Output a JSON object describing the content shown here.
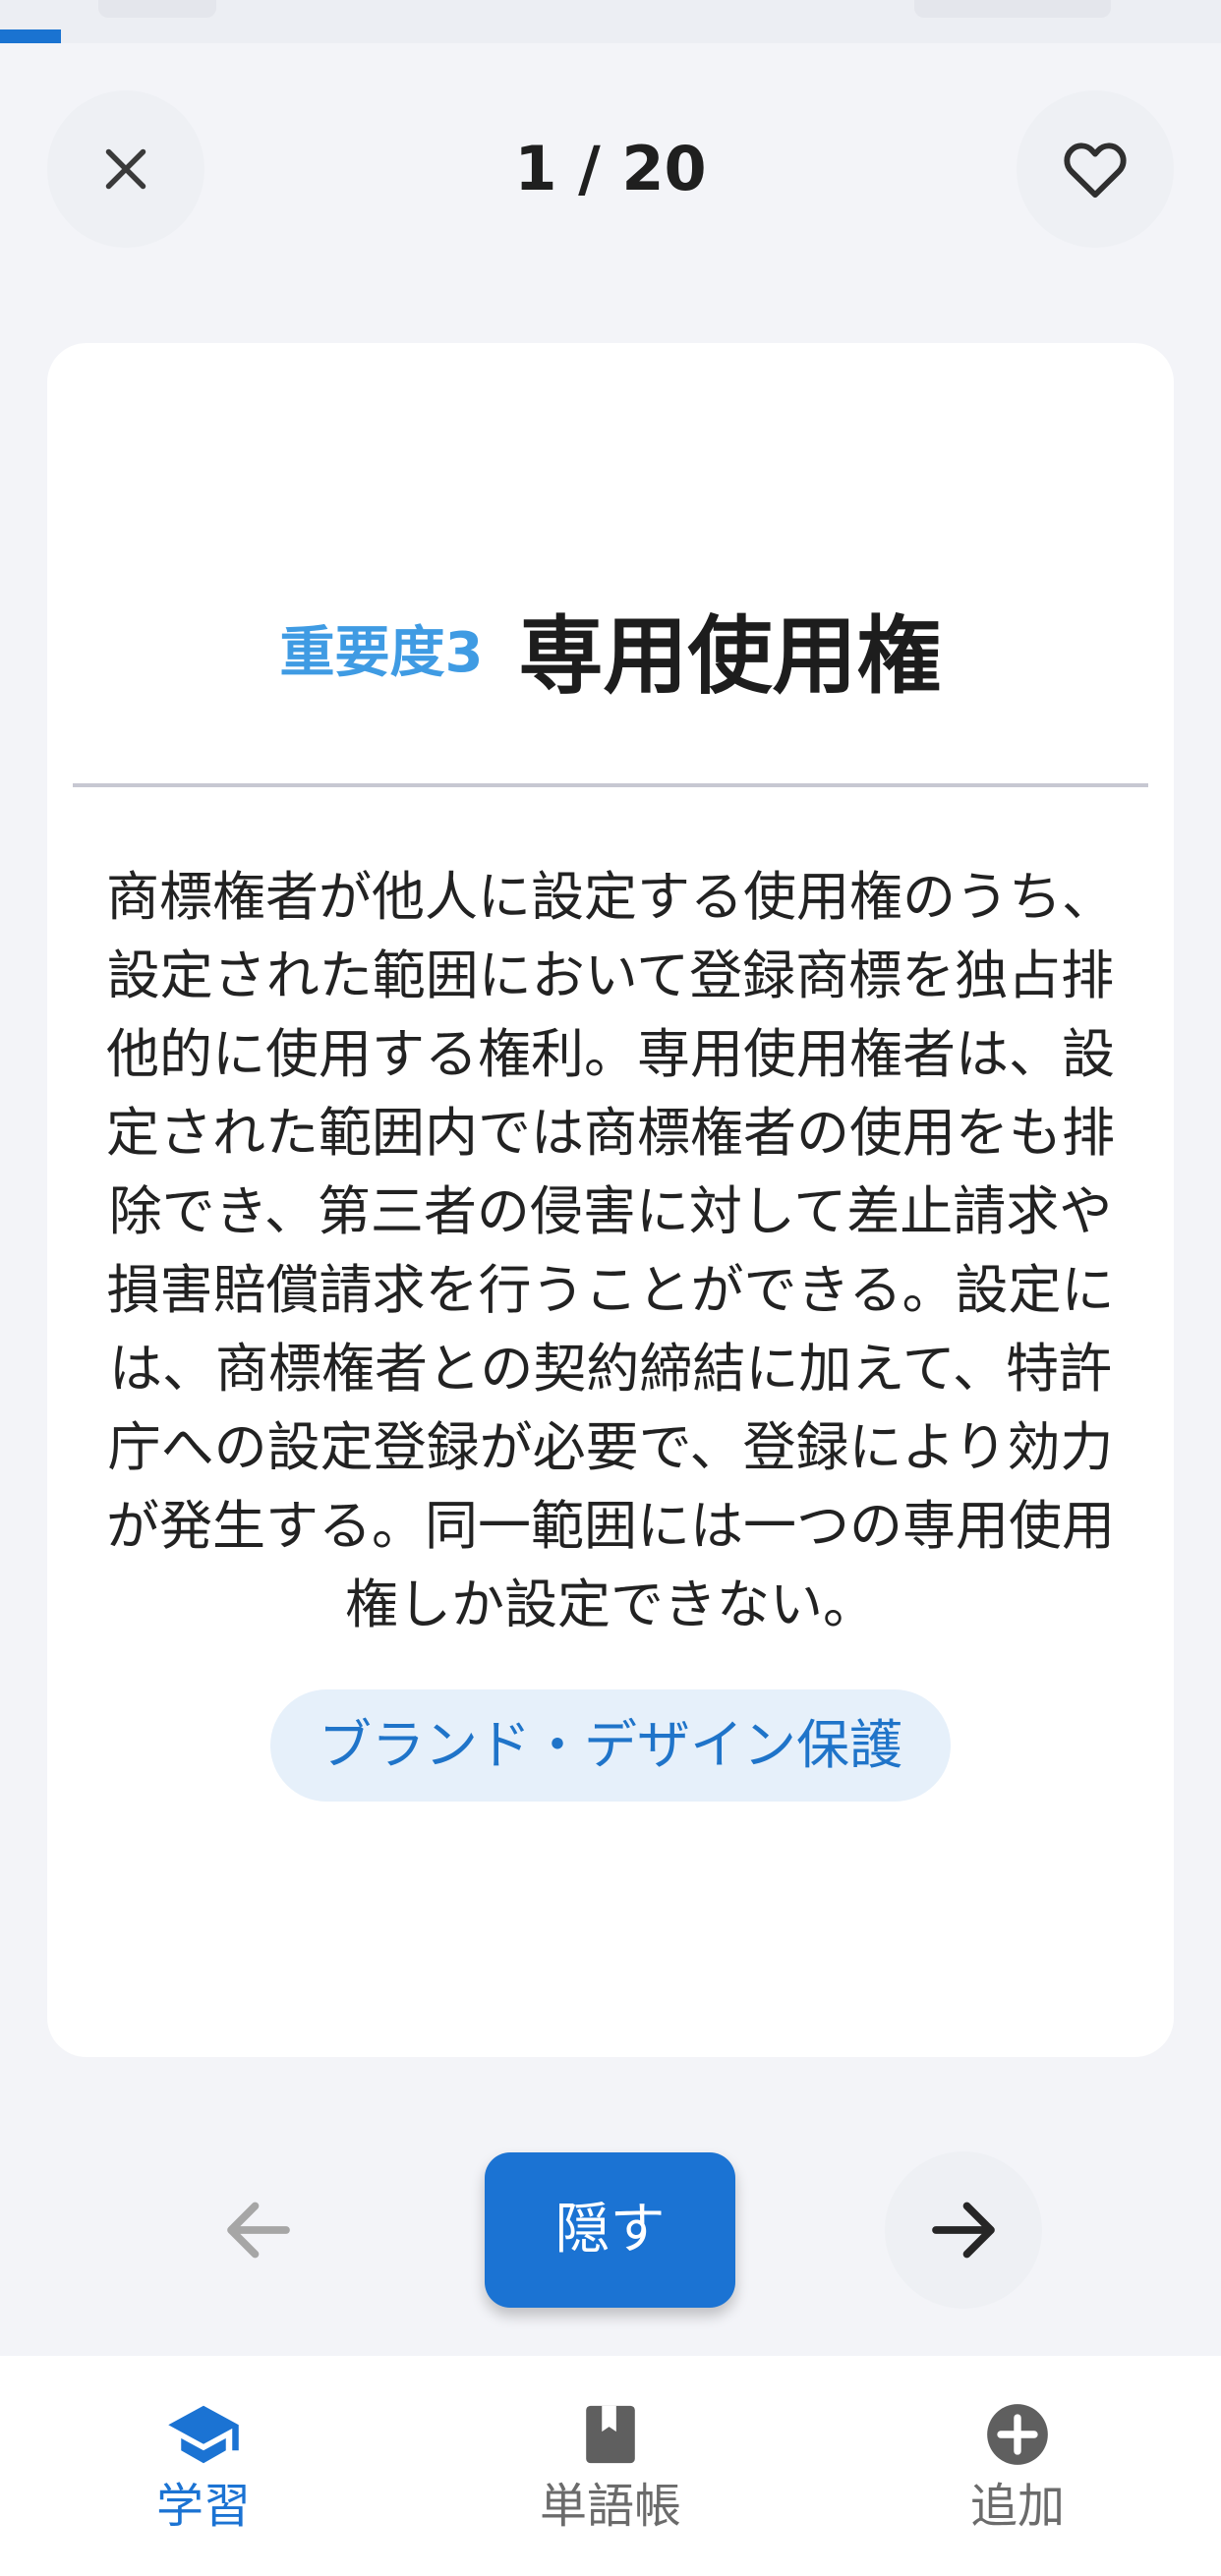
{
  "header": {
    "counter": "1 / 20",
    "close_icon": "close-icon",
    "favorite_icon": "heart-outline-icon"
  },
  "progress": {
    "value": 0.05
  },
  "card": {
    "importance": "重要度3",
    "term": "専用使用権",
    "definition_lines": [
      "商標権者が他人に設定する使用権のうち、",
      "設定された範囲において登録商標を独占排",
      "他的に使用する権利。専用使用権者は、設",
      "定された範囲内では商標権者の使用をも排",
      "除でき、第三者の侵害に対して差止請求や",
      "損害賠償請求を行うことができる。設定に",
      "は、商標権者との契約締結に加えて、特許",
      "庁への設定登録が必要で、登録により効力",
      "が発生する。同一範囲には一つの専用使用",
      "権しか設定できない。"
    ],
    "tag": "ブランド・デザイン保護"
  },
  "controls": {
    "prev_icon": "arrow-left-icon",
    "next_icon": "arrow-right-icon",
    "hide_label": "隠す"
  },
  "bottom_nav": [
    {
      "label": "学習",
      "icon": "graduation-cap-icon",
      "active": true
    },
    {
      "label": "単語帳",
      "icon": "book-icon",
      "active": false
    },
    {
      "label": "追加",
      "icon": "add-circle-icon",
      "active": false
    }
  ],
  "colors": {
    "accent": "#1b73d3",
    "importance": "#3f9be3",
    "tag_bg": "#e6f0fa",
    "inactive": "#6b6b6b"
  }
}
